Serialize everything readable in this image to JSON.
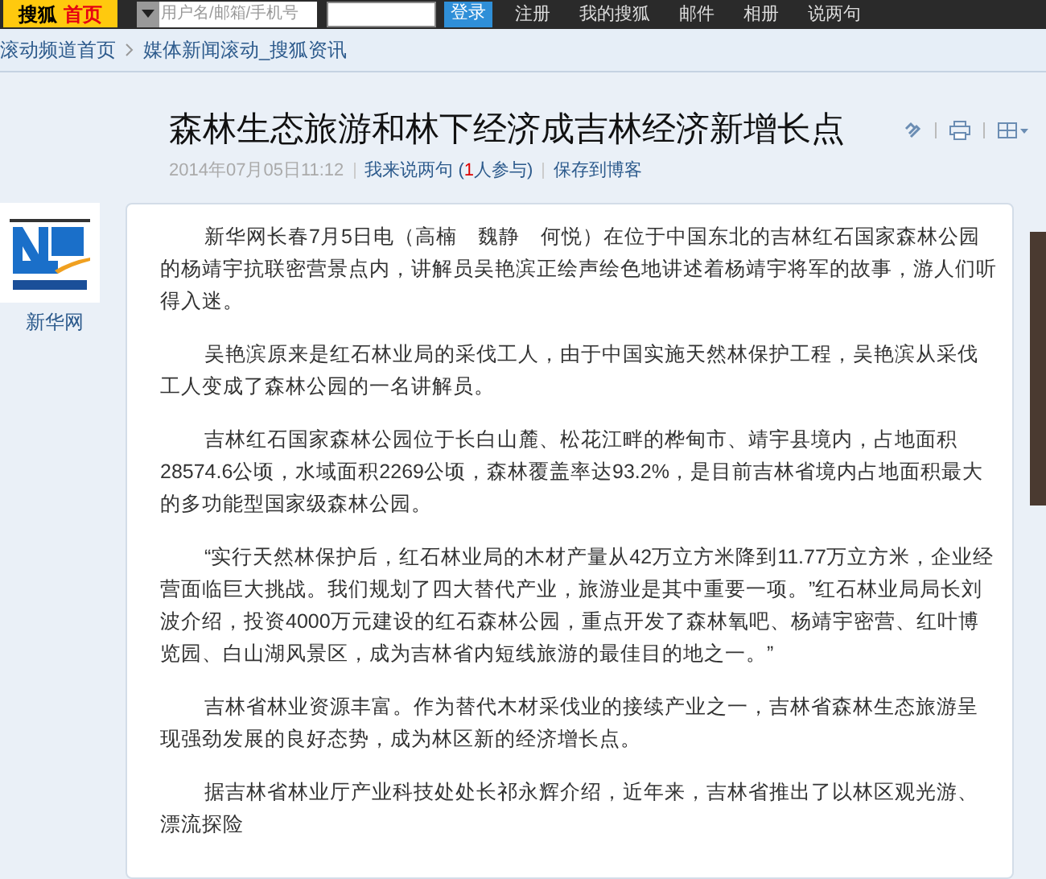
{
  "top_bar": {
    "logo": {
      "brand": "搜狐",
      "home": "首页"
    },
    "username_field": {
      "placeholder": "用户名/邮箱/手机号"
    },
    "login_button": "登录",
    "links": [
      "注册",
      "我的搜狐",
      "邮件",
      "相册",
      "说两句"
    ]
  },
  "breadcrumb": [
    "滚动频道首页",
    "媒体新闻滚动_搜狐资讯"
  ],
  "article": {
    "title": "森林生态旅游和林下经济成吉林经济新增长点",
    "date": "2014年07月05日11:12",
    "comment_link": "我来说两句",
    "comment_count_prefix": "(",
    "comment_count": "1",
    "comment_count_suffix": "人参与)",
    "save_link": "保存到博客",
    "source": {
      "name": "新华网"
    },
    "paragraphs": [
      "新华网长春7月5日电（高楠　魏静　何悦）在位于中国东北的吉林红石国家森林公园的杨靖宇抗联密营景点内，讲解员吴艳滨正绘声绘色地讲述着杨靖宇将军的故事，游人们听得入迷。",
      "吴艳滨原来是红石林业局的采伐工人，由于中国实施天然林保护工程，吴艳滨从采伐工人变成了森林公园的一名讲解员。",
      "吉林红石国家森林公园位于长白山麓、松花江畔的桦甸市、靖宇县境内，占地面积28574.6公顷，水域面积2269公顷，森林覆盖率达93.2%，是目前吉林省境内占地面积最大的多功能型国家级森林公园。",
      "“实行天然林保护后，红石林业局的木材产量从42万立方米降到11.77万立方米，企业经营面临巨大挑战。我们规划了四大替代产业，旅游业是其中重要一项。”红石林业局局长刘波介绍，投资4000万元建设的红石森林公园，重点开发了森林氧吧、杨靖宇密营、红叶博览园、白山湖风景区，成为吉林省内短线旅游的最佳目的地之一。”",
      "吉林省林业资源丰富。作为替代木材采伐业的接续产业之一，吉林省森林生态旅游呈现强劲发展的良好态势，成为林区新的经济增长点。",
      "据吉林省林业厅产业科技处处长祁永辉介绍，近年来，吉林省推出了以林区观光游、漂流探险"
    ]
  }
}
